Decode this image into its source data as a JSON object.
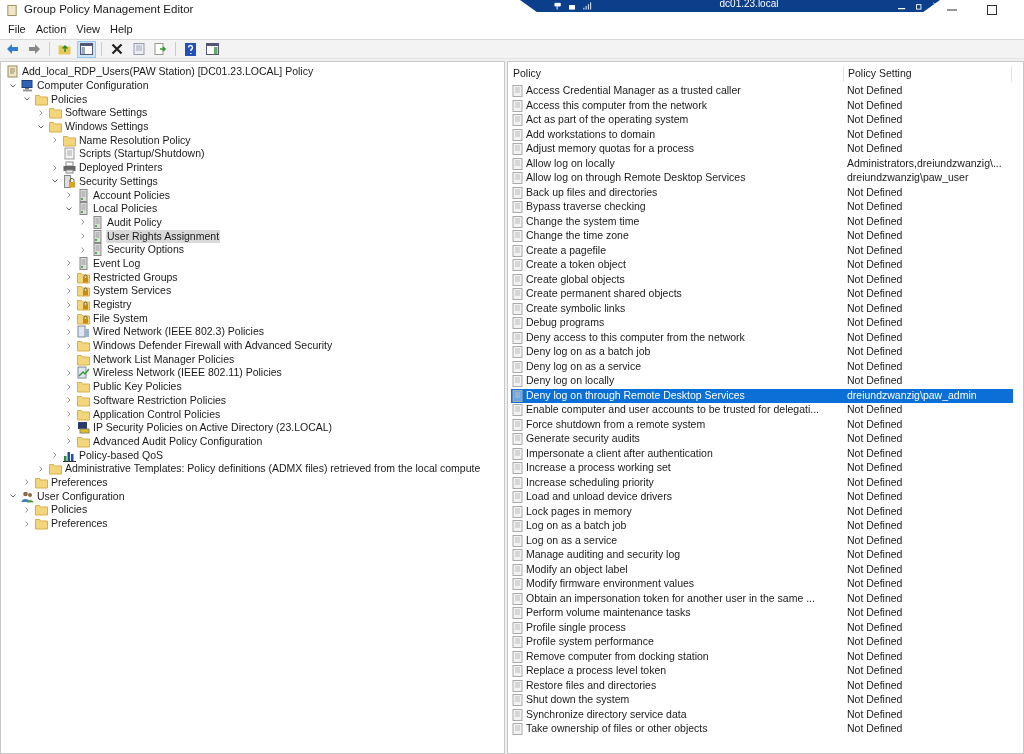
{
  "window": {
    "title": "Group Policy Management Editor"
  },
  "remote_bar": {
    "title": "dc01.23.local"
  },
  "menu": [
    "File",
    "Action",
    "View",
    "Help"
  ],
  "toolbar": [
    [
      {
        "kind": "back",
        "pressed": false
      },
      {
        "kind": "forward",
        "pressed": false
      }
    ],
    [
      {
        "kind": "up",
        "pressed": false
      },
      {
        "kind": "tree",
        "pressed": true
      }
    ],
    [
      {
        "kind": "delete",
        "pressed": false
      },
      {
        "kind": "properties",
        "pressed": false
      },
      {
        "kind": "export",
        "pressed": false
      }
    ],
    [
      {
        "kind": "help",
        "pressed": false
      },
      {
        "kind": "pane",
        "pressed": false
      }
    ]
  ],
  "tree": {
    "label": "Add_local_RDP_Users(PAW Station) [DC01.23.LOCAL] Policy",
    "kind": "gpo",
    "selected": false,
    "children": [
      {
        "label": "Computer Configuration",
        "kind": "computer",
        "expandable": true,
        "expanded": true,
        "selected": false,
        "children": [
          {
            "label": "Policies",
            "kind": "folder",
            "expandable": true,
            "expanded": true,
            "selected": false,
            "children": [
              {
                "label": "Software Settings",
                "kind": "folder",
                "expandable": true,
                "expanded": false,
                "selected": false
              },
              {
                "label": "Windows Settings",
                "kind": "folder",
                "expandable": true,
                "expanded": true,
                "selected": false,
                "children": [
                  {
                    "label": "Name Resolution Policy",
                    "kind": "folder",
                    "expandable": true,
                    "expanded": false,
                    "selected": false
                  },
                  {
                    "label": "Scripts (Startup/Shutdown)",
                    "kind": "script",
                    "expandable": false,
                    "expanded": false,
                    "selected": false
                  },
                  {
                    "label": "Deployed Printers",
                    "kind": "printer",
                    "expandable": true,
                    "expanded": false,
                    "selected": false
                  },
                  {
                    "label": "Security Settings",
                    "kind": "secure",
                    "expandable": true,
                    "expanded": true,
                    "selected": false,
                    "children": [
                      {
                        "label": "Account Policies",
                        "kind": "server",
                        "expandable": true,
                        "expanded": false,
                        "selected": false
                      },
                      {
                        "label": "Local Policies",
                        "kind": "server",
                        "expandable": true,
                        "expanded": true,
                        "selected": false,
                        "children": [
                          {
                            "label": "Audit Policy",
                            "kind": "server",
                            "expandable": true,
                            "expanded": false,
                            "selected": false
                          },
                          {
                            "label": "User Rights Assignment",
                            "kind": "server",
                            "expandable": true,
                            "expanded": false,
                            "selected": true
                          },
                          {
                            "label": "Security Options",
                            "kind": "server",
                            "expandable": true,
                            "expanded": false,
                            "selected": false
                          }
                        ]
                      },
                      {
                        "label": "Event Log",
                        "kind": "server",
                        "expandable": true,
                        "expanded": false,
                        "selected": false
                      },
                      {
                        "label": "Restricted Groups",
                        "kind": "lockfolder",
                        "expandable": true,
                        "expanded": false,
                        "selected": false
                      },
                      {
                        "label": "System Services",
                        "kind": "lockfolder",
                        "expandable": true,
                        "expanded": false,
                        "selected": false
                      },
                      {
                        "label": "Registry",
                        "kind": "lockfolder",
                        "expandable": true,
                        "expanded": false,
                        "selected": false
                      },
                      {
                        "label": "File System",
                        "kind": "lockfolder",
                        "expandable": true,
                        "expanded": false,
                        "selected": false
                      },
                      {
                        "label": "Wired Network (IEEE 802.3) Policies",
                        "kind": "wired",
                        "expandable": true,
                        "expanded": false,
                        "selected": false
                      },
                      {
                        "label": "Windows Defender Firewall with Advanced Security",
                        "kind": "folder",
                        "expandable": true,
                        "expanded": false,
                        "selected": false
                      },
                      {
                        "label": "Network List Manager Policies",
                        "kind": "folder",
                        "expandable": false,
                        "expanded": false,
                        "selected": false
                      },
                      {
                        "label": "Wireless Network (IEEE 802.11) Policies",
                        "kind": "wireless",
                        "expandable": true,
                        "expanded": false,
                        "selected": false
                      },
                      {
                        "label": "Public Key Policies",
                        "kind": "folder",
                        "expandable": true,
                        "expanded": false,
                        "selected": false
                      },
                      {
                        "label": "Software Restriction Policies",
                        "kind": "folder",
                        "expandable": true,
                        "expanded": false,
                        "selected": false
                      },
                      {
                        "label": "Application Control Policies",
                        "kind": "folder",
                        "expandable": true,
                        "expanded": false,
                        "selected": false
                      },
                      {
                        "label": "IP Security Policies on Active Directory (23.LOCAL)",
                        "kind": "ipsec",
                        "expandable": true,
                        "expanded": false,
                        "selected": false
                      },
                      {
                        "label": "Advanced Audit Policy Configuration",
                        "kind": "folder",
                        "expandable": true,
                        "expanded": false,
                        "selected": false
                      }
                    ]
                  },
                  {
                    "label": "Policy-based QoS",
                    "kind": "chart",
                    "expandable": true,
                    "expanded": false,
                    "selected": false
                  }
                ]
              },
              {
                "label": "Administrative Templates: Policy definitions (ADMX files) retrieved from the local compute",
                "kind": "folder",
                "expandable": true,
                "expanded": false,
                "selected": false
              }
            ]
          },
          {
            "label": "Preferences",
            "kind": "folder",
            "expandable": true,
            "expanded": false,
            "selected": false
          }
        ]
      },
      {
        "label": "User Configuration",
        "kind": "user",
        "expandable": true,
        "expanded": true,
        "selected": false,
        "children": [
          {
            "label": "Policies",
            "kind": "folder",
            "expandable": true,
            "expanded": false,
            "selected": false
          },
          {
            "label": "Preferences",
            "kind": "folder",
            "expandable": true,
            "expanded": false,
            "selected": false
          }
        ]
      }
    ]
  },
  "table": {
    "columns": [
      "Policy",
      "Policy Setting"
    ],
    "rows": [
      {
        "policy": "Access Credential Manager as a trusted caller",
        "setting": "Not Defined",
        "selected": false
      },
      {
        "policy": "Access this computer from the network",
        "setting": "Not Defined",
        "selected": false
      },
      {
        "policy": "Act as part of the operating system",
        "setting": "Not Defined",
        "selected": false
      },
      {
        "policy": "Add workstations to domain",
        "setting": "Not Defined",
        "selected": false
      },
      {
        "policy": "Adjust memory quotas for a process",
        "setting": "Not Defined",
        "selected": false
      },
      {
        "policy": "Allow log on locally",
        "setting": "Administrators,dreiundzwanzig\\...",
        "selected": false
      },
      {
        "policy": "Allow log on through Remote Desktop Services",
        "setting": "dreiundzwanzig\\paw_user",
        "selected": false
      },
      {
        "policy": "Back up files and directories",
        "setting": "Not Defined",
        "selected": false
      },
      {
        "policy": "Bypass traverse checking",
        "setting": "Not Defined",
        "selected": false
      },
      {
        "policy": "Change the system time",
        "setting": "Not Defined",
        "selected": false
      },
      {
        "policy": "Change the time zone",
        "setting": "Not Defined",
        "selected": false
      },
      {
        "policy": "Create a pagefile",
        "setting": "Not Defined",
        "selected": false
      },
      {
        "policy": "Create a token object",
        "setting": "Not Defined",
        "selected": false
      },
      {
        "policy": "Create global objects",
        "setting": "Not Defined",
        "selected": false
      },
      {
        "policy": "Create permanent shared objects",
        "setting": "Not Defined",
        "selected": false
      },
      {
        "policy": "Create symbolic links",
        "setting": "Not Defined",
        "selected": false
      },
      {
        "policy": "Debug programs",
        "setting": "Not Defined",
        "selected": false
      },
      {
        "policy": "Deny access to this computer from the network",
        "setting": "Not Defined",
        "selected": false
      },
      {
        "policy": "Deny log on as a batch job",
        "setting": "Not Defined",
        "selected": false
      },
      {
        "policy": "Deny log on as a service",
        "setting": "Not Defined",
        "selected": false
      },
      {
        "policy": "Deny log on locally",
        "setting": "Not Defined",
        "selected": false
      },
      {
        "policy": "Deny log on through Remote Desktop Services",
        "setting": "dreiundzwanzig\\paw_admin",
        "selected": true
      },
      {
        "policy": "Enable computer and user accounts to be trusted for delegati...",
        "setting": "Not Defined",
        "selected": false
      },
      {
        "policy": "Force shutdown from a remote system",
        "setting": "Not Defined",
        "selected": false
      },
      {
        "policy": "Generate security audits",
        "setting": "Not Defined",
        "selected": false
      },
      {
        "policy": "Impersonate a client after authentication",
        "setting": "Not Defined",
        "selected": false
      },
      {
        "policy": "Increase a process working set",
        "setting": "Not Defined",
        "selected": false
      },
      {
        "policy": "Increase scheduling priority",
        "setting": "Not Defined",
        "selected": false
      },
      {
        "policy": "Load and unload device drivers",
        "setting": "Not Defined",
        "selected": false
      },
      {
        "policy": "Lock pages in memory",
        "setting": "Not Defined",
        "selected": false
      },
      {
        "policy": "Log on as a batch job",
        "setting": "Not Defined",
        "selected": false
      },
      {
        "policy": "Log on as a service",
        "setting": "Not Defined",
        "selected": false
      },
      {
        "policy": "Manage auditing and security log",
        "setting": "Not Defined",
        "selected": false
      },
      {
        "policy": "Modify an object label",
        "setting": "Not Defined",
        "selected": false
      },
      {
        "policy": "Modify firmware environment values",
        "setting": "Not Defined",
        "selected": false
      },
      {
        "policy": "Obtain an impersonation token for another user in the same ...",
        "setting": "Not Defined",
        "selected": false
      },
      {
        "policy": "Perform volume maintenance tasks",
        "setting": "Not Defined",
        "selected": false
      },
      {
        "policy": "Profile single process",
        "setting": "Not Defined",
        "selected": false
      },
      {
        "policy": "Profile system performance",
        "setting": "Not Defined",
        "selected": false
      },
      {
        "policy": "Remove computer from docking station",
        "setting": "Not Defined",
        "selected": false
      },
      {
        "policy": "Replace a process level token",
        "setting": "Not Defined",
        "selected": false
      },
      {
        "policy": "Restore files and directories",
        "setting": "Not Defined",
        "selected": false
      },
      {
        "policy": "Shut down the system",
        "setting": "Not Defined",
        "selected": false
      },
      {
        "policy": "Synchronize directory service data",
        "setting": "Not Defined",
        "selected": false
      },
      {
        "policy": "Take ownership of files or other objects",
        "setting": "Not Defined",
        "selected": false
      }
    ]
  }
}
